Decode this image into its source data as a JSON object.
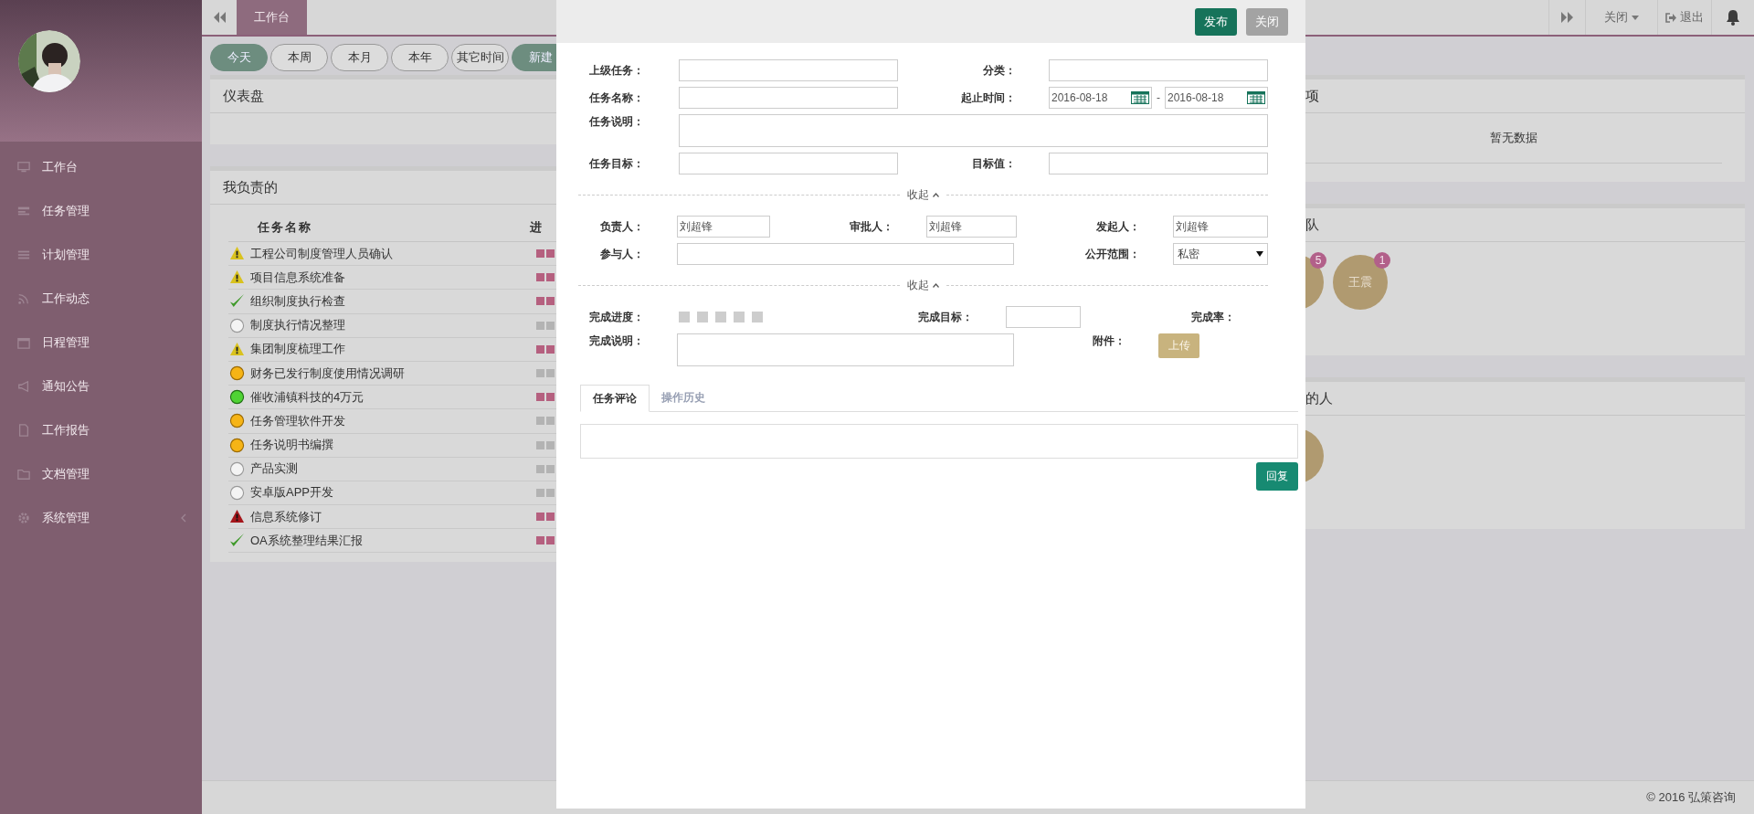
{
  "sidebar": {
    "items": [
      {
        "label": "工作台"
      },
      {
        "label": "任务管理"
      },
      {
        "label": "计划管理"
      },
      {
        "label": "工作动态"
      },
      {
        "label": "日程管理"
      },
      {
        "label": "通知公告"
      },
      {
        "label": "工作报告"
      },
      {
        "label": "文档管理"
      },
      {
        "label": "系统管理",
        "expandable": true
      }
    ]
  },
  "top_bar": {
    "tabs": [
      {
        "label": "工作台",
        "selected": true
      }
    ],
    "close_menu": "关闭",
    "logout": "退出"
  },
  "filters": [
    {
      "label": "今天",
      "selected": true
    },
    {
      "label": "本周",
      "selected": false
    },
    {
      "label": "本月",
      "selected": false
    },
    {
      "label": "本年",
      "selected": false
    },
    {
      "label": "其它时间",
      "selected": false
    },
    {
      "label": "新建",
      "selected": true
    }
  ],
  "dashboard": {
    "title": "仪表盘"
  },
  "my_tasks": {
    "title": "我负责的",
    "columns": [
      "任务名称",
      "进"
    ],
    "rows": [
      {
        "name": "工程公司制度管理人员确认",
        "kind": "warning",
        "started": true
      },
      {
        "name": "项目信息系统准备",
        "kind": "warning",
        "started": true
      },
      {
        "name": "组织制度执行检查",
        "kind": "done",
        "started": true
      },
      {
        "name": "制度执行情况整理",
        "kind": "pending",
        "started": false
      },
      {
        "name": "集团制度梳理工作",
        "kind": "warning",
        "started": true
      },
      {
        "name": "财务已发行制度使用情况调研",
        "kind": "active",
        "started": false
      },
      {
        "name": "催收浦镇科技的4万元",
        "kind": "ok",
        "started": true
      },
      {
        "name": "任务管理软件开发",
        "kind": "active",
        "started": false
      },
      {
        "name": "任务说明书编撰",
        "kind": "active",
        "started": false
      },
      {
        "name": "产品实测",
        "kind": "pending",
        "started": false
      },
      {
        "name": "安卓版APP开发",
        "kind": "pending",
        "started": false
      },
      {
        "name": "信息系统修订",
        "kind": "overdue",
        "started": true
      },
      {
        "name": "OA系统整理结果汇报",
        "kind": "done",
        "started": true
      }
    ]
  },
  "right_panels": [
    {
      "title": "项",
      "empty_text": "暂无数据"
    },
    {
      "title": "队",
      "members": [
        {
          "partial": true,
          "badge": "5"
        },
        {
          "partial": false,
          "name": "王震",
          "badge": "1"
        }
      ]
    },
    {
      "title": "的人",
      "members": [
        {
          "partial": true
        }
      ]
    }
  ],
  "footer": {
    "copyright": "© 2016 弘策咨询"
  },
  "modal": {
    "buttons": [
      {
        "label": "发布",
        "kind": "primary"
      },
      {
        "label": "关闭",
        "kind": "secondary"
      }
    ],
    "parent_task": {
      "label": "上级任务："
    },
    "category": {
      "label": "分类："
    },
    "task_name": {
      "label": "任务名称："
    },
    "period": {
      "label": "起止时间：",
      "start": "2016-08-18",
      "separator": "-",
      "end": "2016-08-18"
    },
    "description": {
      "label": "任务说明："
    },
    "goal": {
      "label": "任务目标："
    },
    "target_value": {
      "label": "目标值："
    },
    "collapse_1": "收起",
    "owner": {
      "label": "负责人：",
      "value": "刘超锋"
    },
    "approver": {
      "label": "审批人：",
      "value": "刘超锋"
    },
    "initiator": {
      "label": "发起人：",
      "value": "刘超锋"
    },
    "participants": {
      "label": "参与人："
    },
    "visibility": {
      "label": "公开范围：",
      "value": "私密"
    },
    "collapse_2": "收起",
    "progress": {
      "label": "完成进度：",
      "level": 0
    },
    "completion_target": {
      "label": "完成目标："
    },
    "completion_rate": {
      "label": "完成率："
    },
    "completion_note": {
      "label": "完成说明："
    },
    "attachment": {
      "label": "附件：",
      "button": "上传"
    },
    "tabs": [
      {
        "label": "任务评论",
        "selected": true
      },
      {
        "label": "操作历史",
        "selected": false
      }
    ],
    "reply_button": "回复"
  }
}
